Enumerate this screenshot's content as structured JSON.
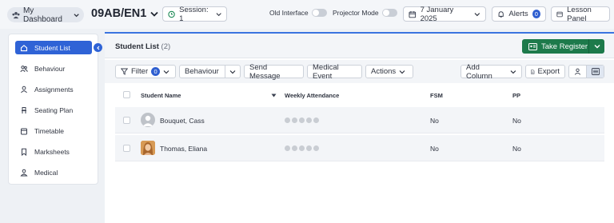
{
  "topbar": {
    "dashboard_label": "My Dashboard",
    "class_title": "09AB/EN1",
    "session_label": "Session: 1",
    "old_interface_label": "Old Interface",
    "projector_mode_label": "Projector Mode",
    "date_label": "7 January 2025",
    "alerts_label": "Alerts",
    "alerts_count": "0",
    "lesson_panel_label": "Lesson Panel"
  },
  "sidebar": {
    "items": [
      {
        "label": "Student List",
        "icon": "home-icon",
        "active": true
      },
      {
        "label": "Behaviour",
        "icon": "users-icon"
      },
      {
        "label": "Assignments",
        "icon": "user-icon"
      },
      {
        "label": "Seating Plan",
        "icon": "chair-icon"
      },
      {
        "label": "Timetable",
        "icon": "calendar-icon"
      },
      {
        "label": "Marksheets",
        "icon": "bookmark-icon"
      },
      {
        "label": "Medical",
        "icon": "medical-icon"
      }
    ]
  },
  "main": {
    "title": "Student List",
    "count": "(2)",
    "take_register_label": "Take Register"
  },
  "toolbar": {
    "filter_label": "Filter",
    "filter_count": "0",
    "behaviour_label": "Behaviour",
    "send_message_label": "Send Message",
    "medical_event_label": "Medical Event",
    "actions_label": "Actions",
    "add_column_label": "Add Column",
    "export_label": "Export"
  },
  "table": {
    "columns": [
      "Student Name",
      "Weekly Attendance",
      "FSM",
      "PP"
    ],
    "rows": [
      {
        "name": "Bouquet, Cass",
        "fsm": "No",
        "pp": "No",
        "avatar": "placeholder"
      },
      {
        "name": "Thomas, Eliana",
        "fsm": "No",
        "pp": "No",
        "avatar": "photo"
      }
    ]
  },
  "colors": {
    "accent": "#2f63d6",
    "register_green": "#1d7a4b",
    "background": "#eef1f5"
  }
}
